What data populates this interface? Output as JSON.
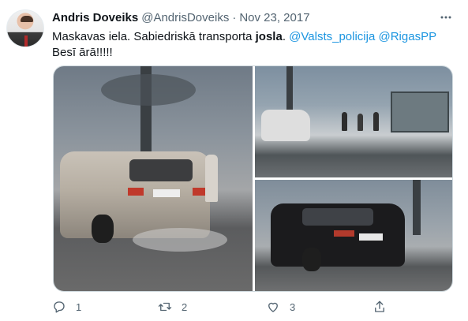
{
  "tweet": {
    "author_name": "Andris Doveiks",
    "author_handle": "@AndrisDoveiks",
    "separator": "·",
    "date": "Nov 23, 2017",
    "text": {
      "part1": "Maskavas iela. Sabiedriskā transporta ",
      "bold": "josla",
      "part2": ". ",
      "mention1": "@Valsts_policija",
      "part3": " ",
      "mention2": "@RigasPP",
      "part4": " Besī ārā!!!!!"
    }
  },
  "actions": {
    "reply_count": "1",
    "retweet_count": "2",
    "like_count": "3",
    "share_count": ""
  },
  "icons": {
    "more": "more-horizontal-icon",
    "reply": "reply-icon",
    "retweet": "retweet-icon",
    "like": "heart-icon",
    "share": "share-icon"
  },
  "colors": {
    "link": "#1b95e0",
    "secondary": "#536471",
    "text": "#0f1419"
  }
}
